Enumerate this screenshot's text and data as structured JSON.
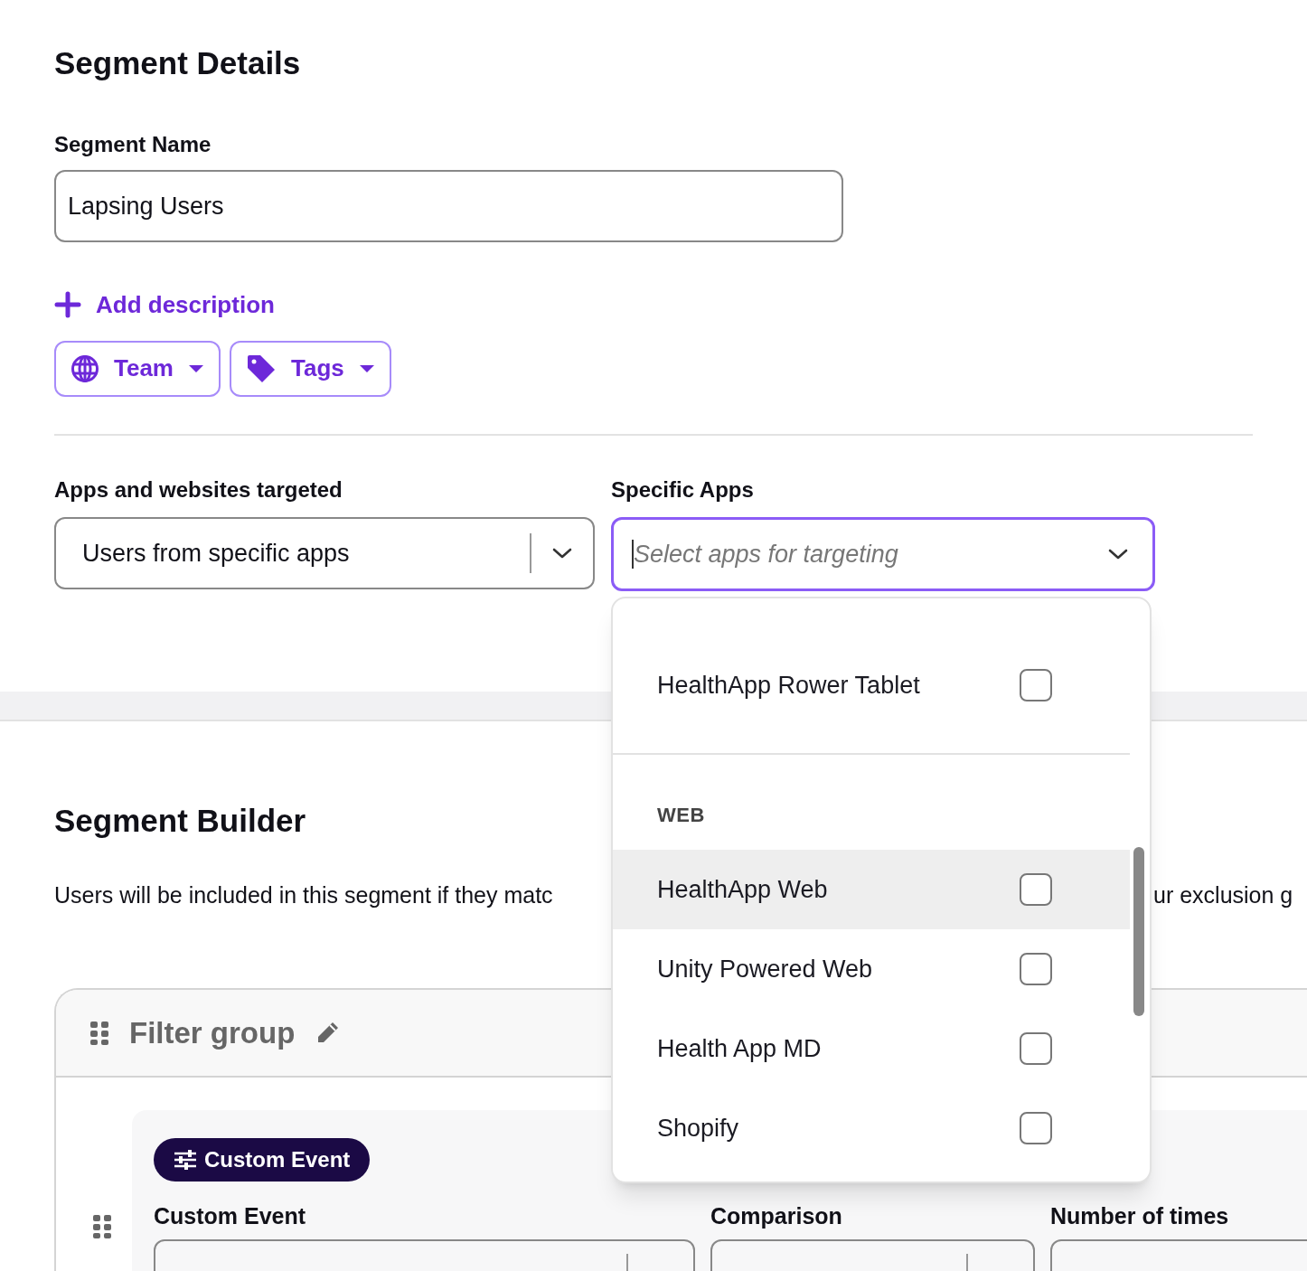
{
  "segment_details": {
    "title": "Segment Details",
    "name_label": "Segment Name",
    "name_value": "Lapsing Users",
    "add_description": "Add description",
    "chips": [
      {
        "kind": "globe",
        "label": "Team"
      },
      {
        "kind": "tag",
        "label": "Tags"
      }
    ]
  },
  "targeting": {
    "apps_label": "Apps and websites targeted",
    "apps_value": "Users from specific apps",
    "specific_label": "Specific Apps",
    "specific_placeholder": "Select apps for targeting",
    "expanded": true
  },
  "dropdown": {
    "items": [
      {
        "kind": "option",
        "label": "HealthApp Rower Tablet",
        "checked": false,
        "hovered": false
      },
      {
        "kind": "divider"
      },
      {
        "kind": "header",
        "label": "WEB"
      },
      {
        "kind": "option",
        "label": "HealthApp Web",
        "checked": false,
        "hovered": true
      },
      {
        "kind": "option",
        "label": "Unity Powered Web",
        "checked": false,
        "hovered": false
      },
      {
        "kind": "option",
        "label": "Health App MD",
        "checked": false,
        "hovered": false
      },
      {
        "kind": "option",
        "label": "Shopify",
        "checked": false,
        "hovered": false
      }
    ]
  },
  "segment_builder": {
    "title": "Segment Builder",
    "description_left": "Users will be included in this segment if they matc",
    "description_right": "ur exclusion g",
    "filter_group": {
      "title": "Filter group",
      "badge": "Custom Event",
      "columns": [
        "Custom Event",
        "Comparison",
        "Number of times"
      ]
    }
  }
}
